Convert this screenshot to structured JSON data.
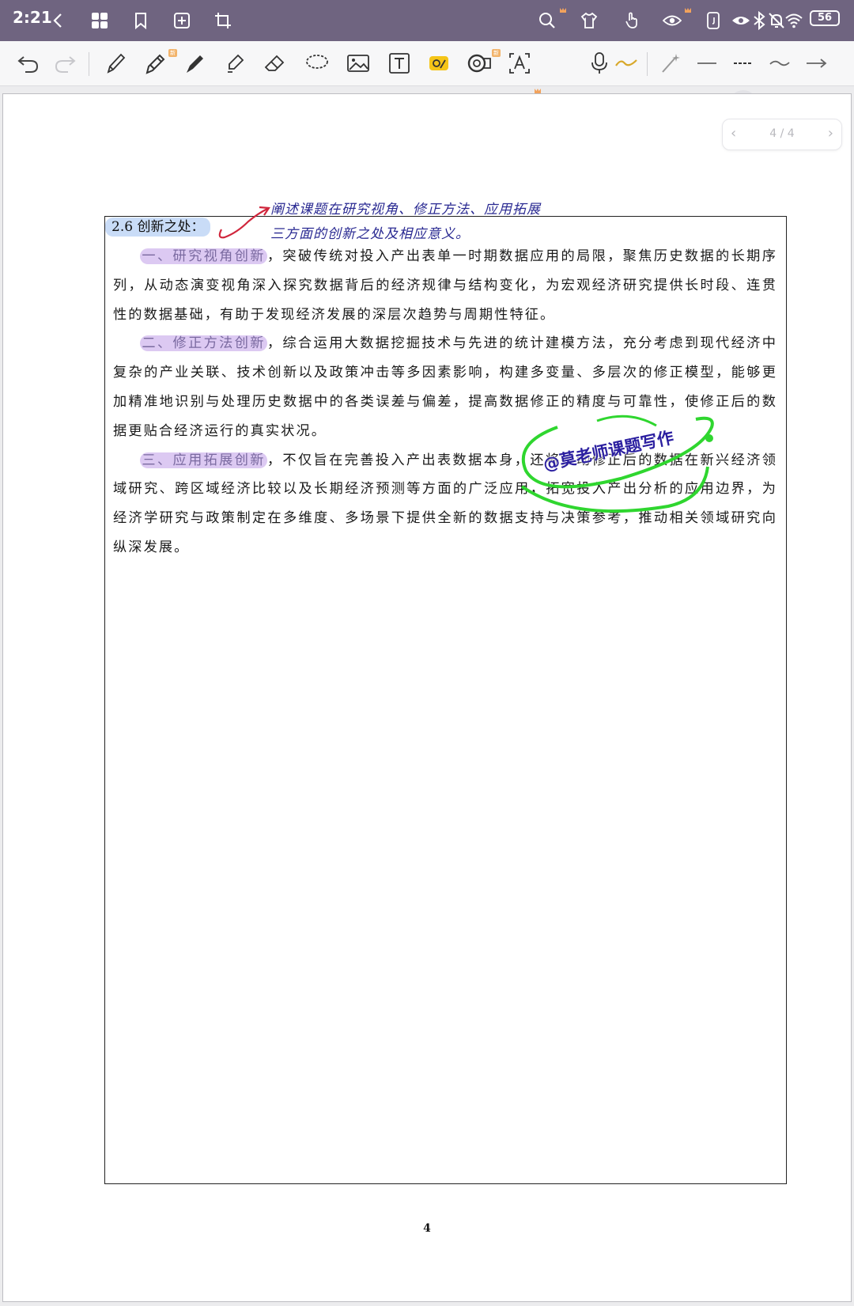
{
  "status_bar": {
    "time": "2:21",
    "battery": "56"
  },
  "toolbar": {
    "tools": [
      "undo",
      "redo",
      "pencil",
      "pen",
      "fountain-pen",
      "highlighter",
      "eraser",
      "lasso",
      "image",
      "text-box",
      "sticker",
      "tape",
      "text-recognition",
      "ai",
      "voice",
      "curve",
      "laser-pointer",
      "line-solid",
      "line-dashed",
      "line-wavy",
      "arrow"
    ],
    "ai_label": "AI",
    "active_line_style": "line-dashed"
  },
  "pager": {
    "prev_glyph": "‹",
    "next_glyph": "›",
    "page_indicator": "4 / 4"
  },
  "document": {
    "heading": "2.6 创新之处：",
    "handwritten_note_line1": "阐述课题在研究视角、修正方法、应用拓展",
    "handwritten_note_line2": "三方面的创新之处及相应意义。",
    "paragraphs": [
      {
        "label": "一、研究视角创新",
        "text": "，突破传统对投入产出表单一时期数据应用的局限，聚焦历史数据的长期序列，从动态演变视角深入探究数据背后的经济规律与结构变化，为宏观经济研究提供长时段、连贯性的数据基础，有助于发现经济发展的深层次趋势与周期性特征。"
      },
      {
        "label": "二、修正方法创新",
        "text": "，综合运用大数据挖掘技术与先进的统计建模方法，充分考虑到现代经济中复杂的产业关联、技术创新以及政策冲击等多因素影响，构建多变量、多层次的修正模型，能够更加精准地识别与处理历史数据中的各类误差与偏差，提高数据修正的精度与可靠性，使修正后的数据更贴合经济运行的真实状况。"
      },
      {
        "label": "三、应用拓展创新",
        "text": "，不仅旨在完善投入产出表数据本身，还将推动修正后的数据在新兴经济领域研究、跨区域经济比较以及长期经济预测等方面的广泛应用，拓宽投入产出分析的应用边界，为经济学研究与政策制定在多维度、多场景下提供全新的数据支持与决策参考，推动相关领域研究向纵深发展。"
      }
    ],
    "watermark": "@莫老师课题写作",
    "page_number": "4"
  },
  "colors": {
    "status_bar_bg": "#6f6480",
    "heading_highlight": "#c9dcf7",
    "label_highlight": "#dcc9f2",
    "annotation_ink": "#2a2a92",
    "arrow_ink": "#d0263c",
    "watermark_stroke": "#2fd62f"
  }
}
